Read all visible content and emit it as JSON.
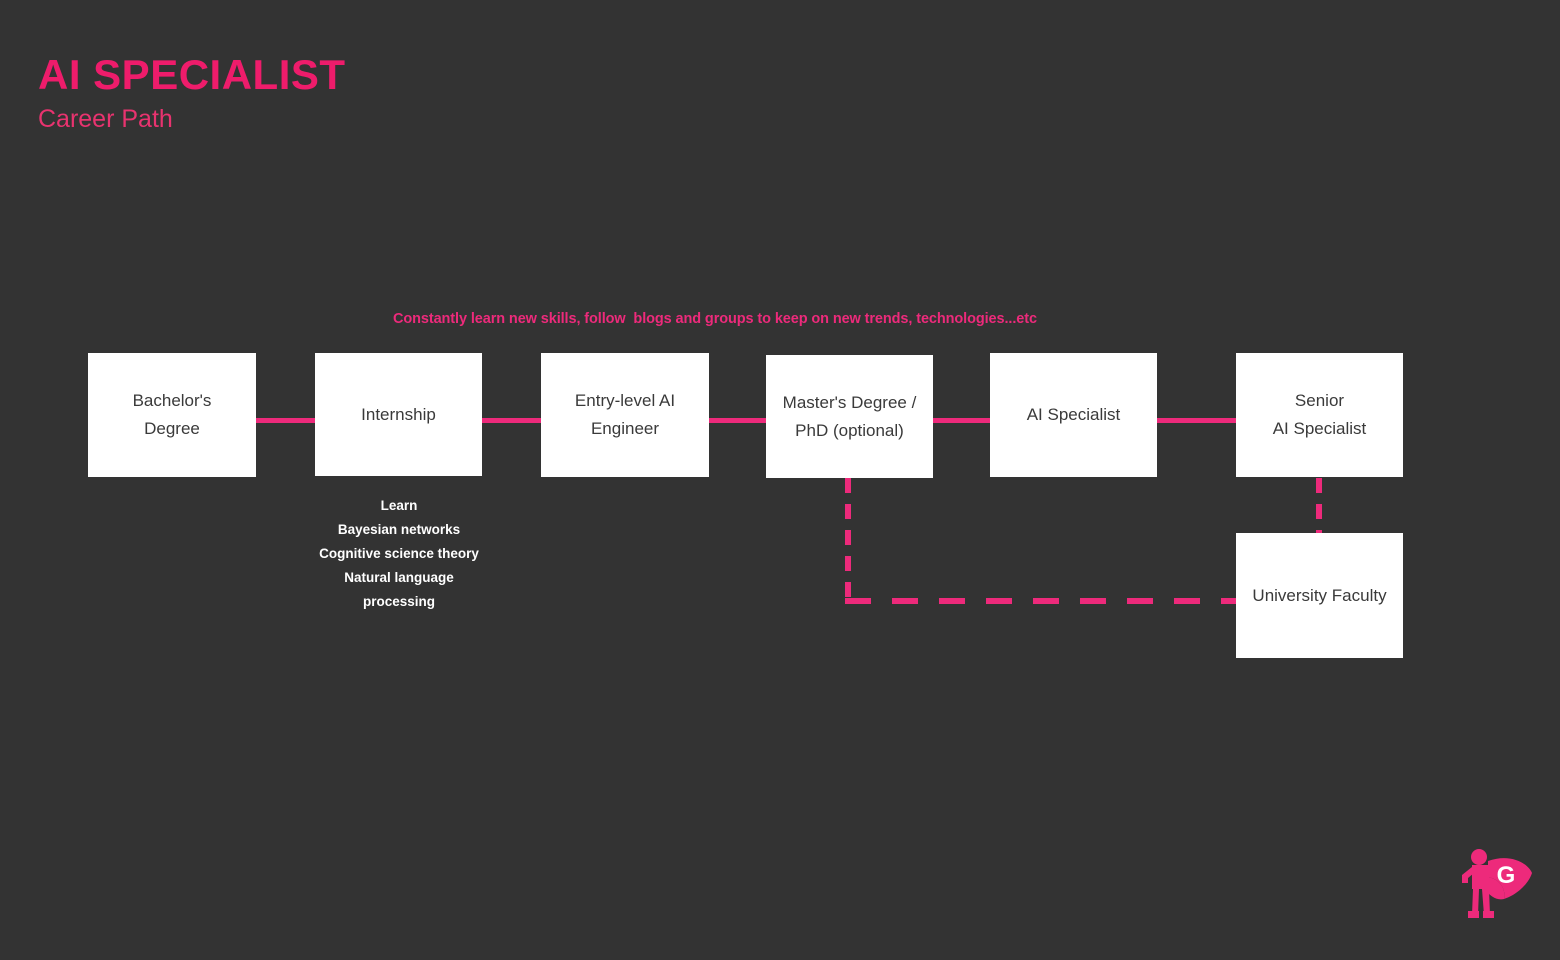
{
  "header": {
    "title": "AI SPECIALIST",
    "subtitle": "Career Path"
  },
  "annotation": {
    "text": "Constantly learn new skills, follow  blogs and groups to keep on new trends, technologies...etc"
  },
  "nodes": [
    {
      "id": "bachelors",
      "label": "Bachelor's\nDegree"
    },
    {
      "id": "internship",
      "label": "Internship"
    },
    {
      "id": "entry",
      "label": "Entry-level AI\nEngineer"
    },
    {
      "id": "masters",
      "label": "Master's Degree /\nPhD (optional)"
    },
    {
      "id": "specialist",
      "label": "AI Specialist"
    },
    {
      "id": "senior",
      "label": "Senior\nAI Specialist"
    },
    {
      "id": "faculty",
      "label": "University Faculty"
    }
  ],
  "skills": {
    "heading": "Learn",
    "items": [
      "Bayesian networks",
      "Cognitive science theory",
      "Natural language\nprocessing"
    ]
  },
  "logo": {
    "letter": "G"
  },
  "colors": {
    "background": "#333333",
    "accent": "#ED2A7B",
    "title": "#EE1C6B",
    "box_fill": "#FFFFFF",
    "box_text": "#3A3A3A",
    "skill_text": "#FFFFFF"
  }
}
